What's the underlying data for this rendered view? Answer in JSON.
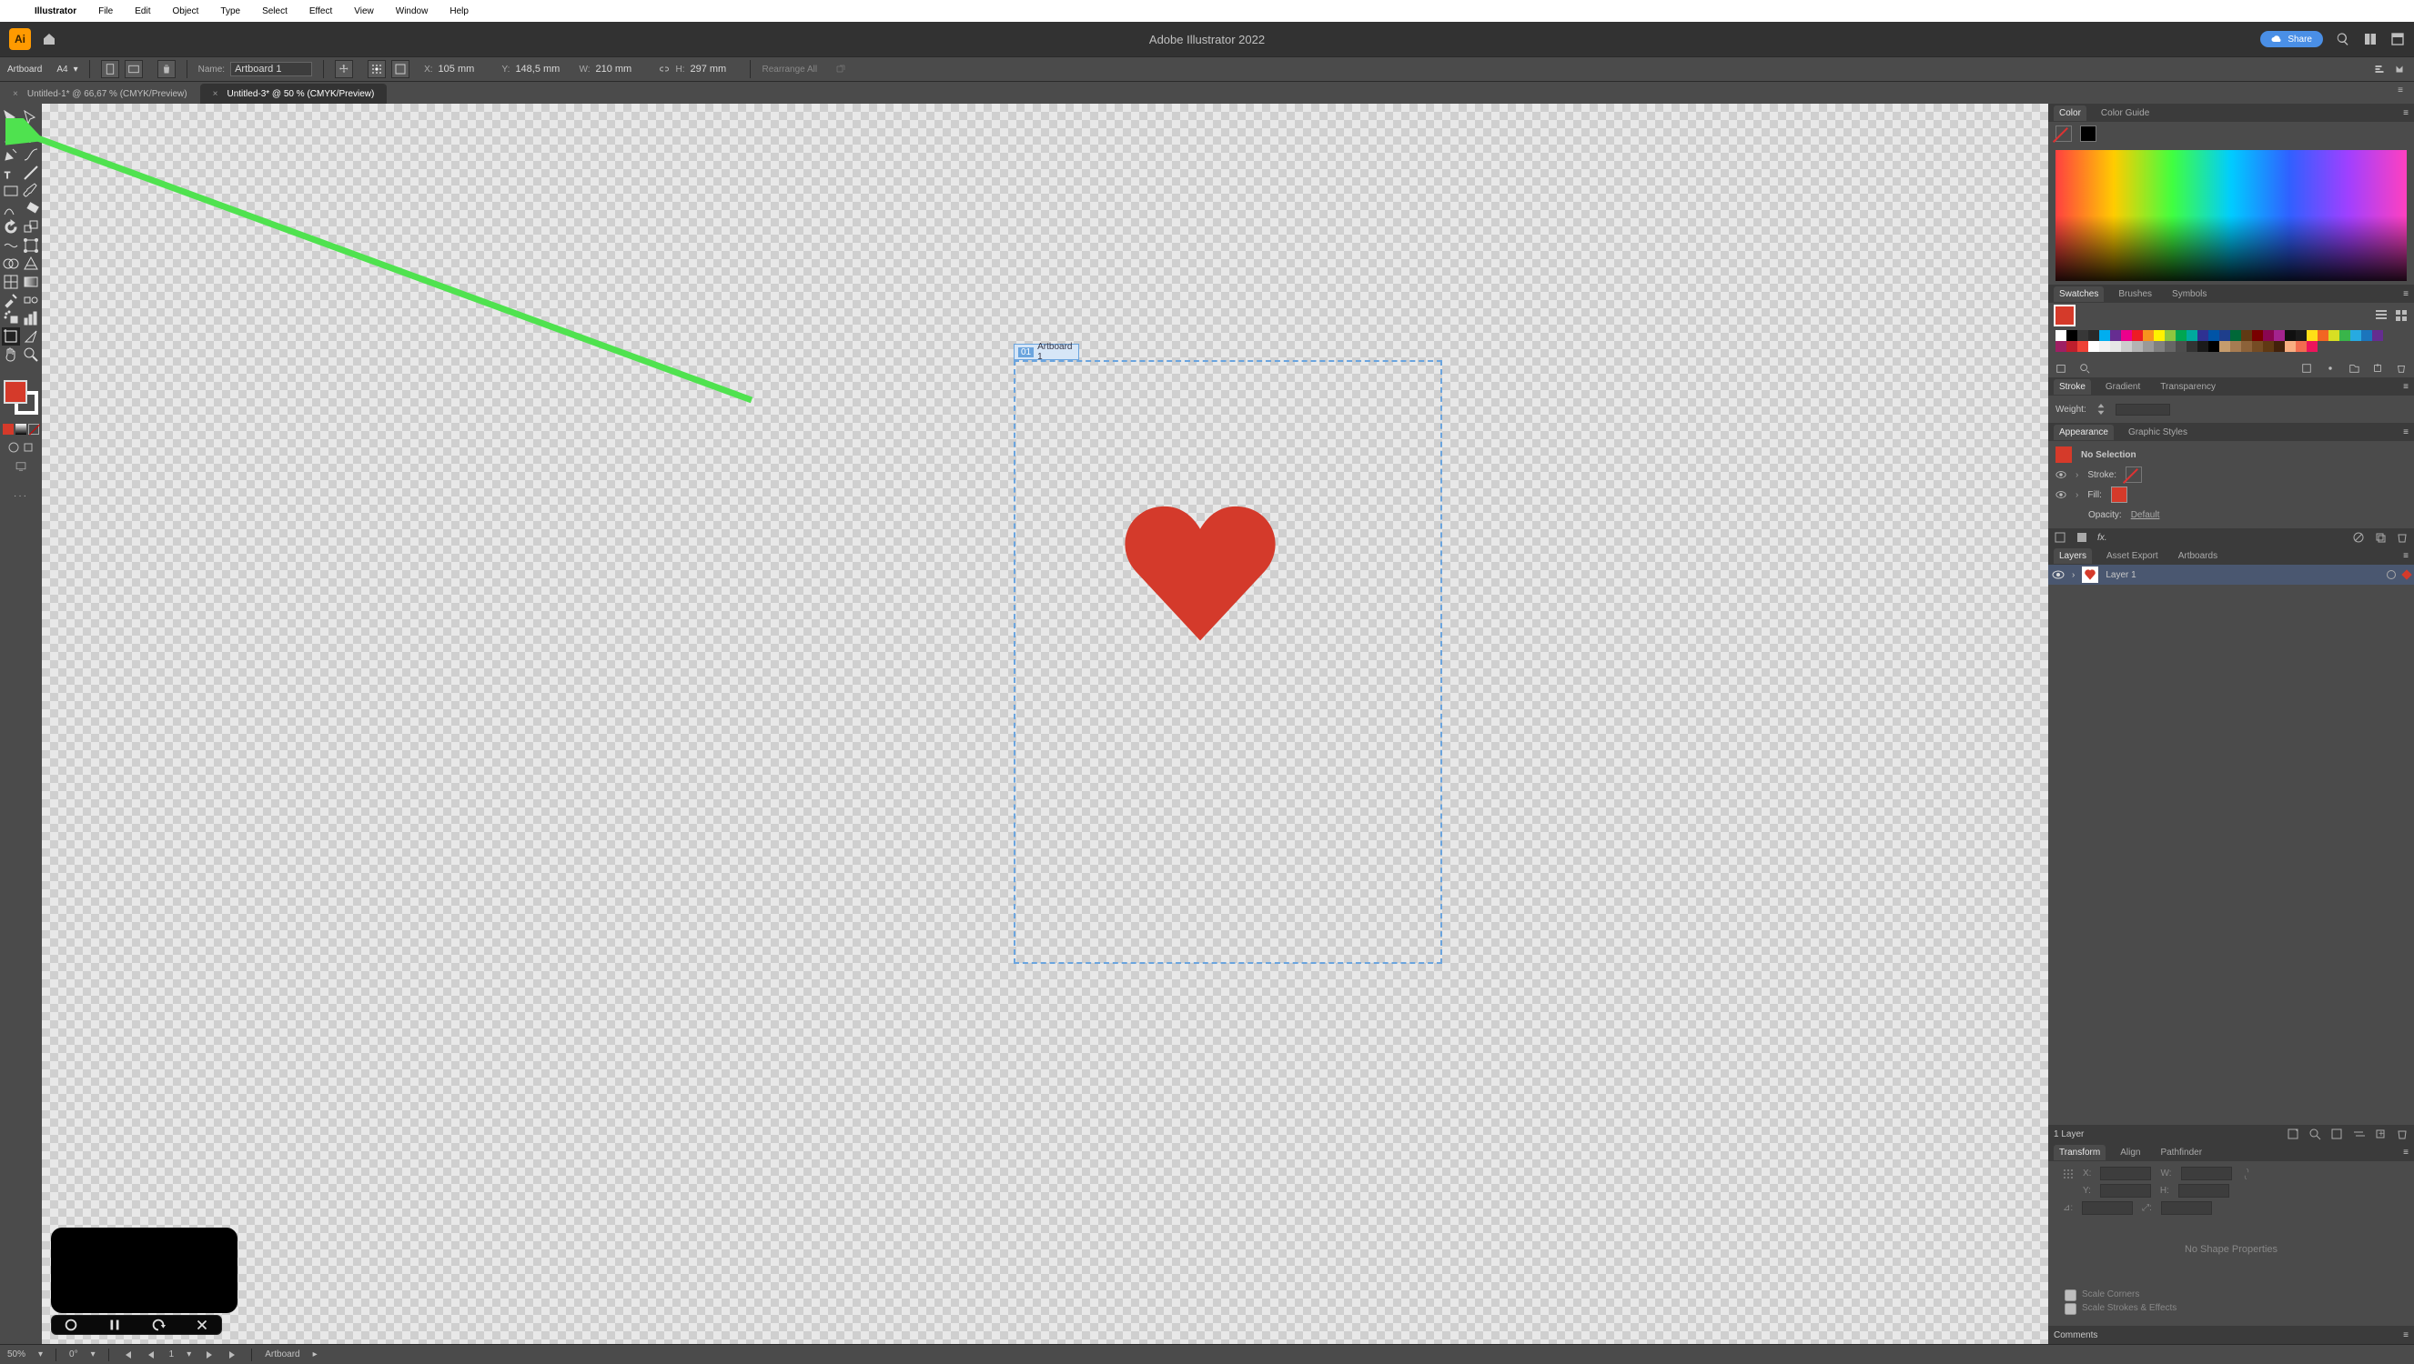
{
  "mac_menu": [
    "Illustrator",
    "File",
    "Edit",
    "Object",
    "Type",
    "Select",
    "Effect",
    "View",
    "Window",
    "Help"
  ],
  "doc_title": "Adobe Illustrator 2022",
  "share_label": "Share",
  "control_bar": {
    "tool_label": "Artboard",
    "preset": "A4",
    "name_lbl": "Name:",
    "name_val": "Artboard 1",
    "x_lbl": "X:",
    "x_val": "105 mm",
    "y_lbl": "Y:",
    "y_val": "148,5 mm",
    "w_lbl": "W:",
    "w_val": "210 mm",
    "h_lbl": "H:",
    "h_val": "297 mm",
    "rearrange": "Rearrange All"
  },
  "tabs": [
    {
      "label": "Untitled-1* @ 66,67 % (CMYK/Preview)",
      "active": false
    },
    {
      "label": "Untitled-3* @ 50 % (CMYK/Preview)",
      "active": true
    }
  ],
  "artboard_num": "01",
  "artboard_name": "Artboard 1",
  "panels": {
    "color_tabs": [
      "Color",
      "Color Guide"
    ],
    "swatches_tabs": [
      "Swatches",
      "Brushes",
      "Symbols"
    ],
    "stroke_tabs": [
      "Stroke",
      "Gradient",
      "Transparency"
    ],
    "weight_lbl": "Weight:",
    "appearance_tabs": [
      "Appearance",
      "Graphic Styles"
    ],
    "no_sel": "No Selection",
    "stroke_lbl": "Stroke:",
    "fill_lbl": "Fill:",
    "opacity_lbl": "Opacity:",
    "opacity_val": "Default",
    "layers_tabs": [
      "Layers",
      "Asset Export",
      "Artboards"
    ],
    "layer1": "Layer 1",
    "layer_footer": "1 Layer",
    "transform_tabs": [
      "Transform",
      "Align",
      "Pathfinder"
    ],
    "noshape": "No Shape Properties",
    "scale_corners": "Scale Corners",
    "scale_strokes": "Scale Strokes & Effects",
    "comments": "Comments"
  },
  "status": {
    "zoom": "50%",
    "rotate": "0°",
    "ab_nav": "1",
    "label": "Artboard"
  },
  "swatch_colors": [
    "#ffffff",
    "#000000",
    "#373737",
    "#2a2a2a",
    "#00aeef",
    "#662d91",
    "#ec008c",
    "#ed1c24",
    "#f7941d",
    "#fff200",
    "#8dc63f",
    "#00a651",
    "#00a99d",
    "#2e3192",
    "#0054a6",
    "#1e3e8c",
    "#006838",
    "#603913",
    "#790000",
    "#8a0651",
    "#a3238e",
    "#101010",
    "#1a1a1a",
    "#ffde17",
    "#f26522",
    "#d7df23",
    "#39b54a",
    "#27aae1",
    "#1b75bc",
    "#652d90",
    "#9e1f63",
    "#be1e2d",
    "#ef4136",
    "#ffffff",
    "#f1f1f1",
    "#e6e6e6",
    "#cccccc",
    "#b3b3b3",
    "#999999",
    "#808080",
    "#666666",
    "#4d4d4d",
    "#333333",
    "#1a1a1a",
    "#000000",
    "#c69c6d",
    "#a67c52",
    "#8c6239",
    "#754c24",
    "#603913",
    "#42210b",
    "#f9ad81",
    "#f26c4f",
    "#ed145b"
  ],
  "accent": "#d53a2a",
  "arrow_color": "#4fe24f"
}
